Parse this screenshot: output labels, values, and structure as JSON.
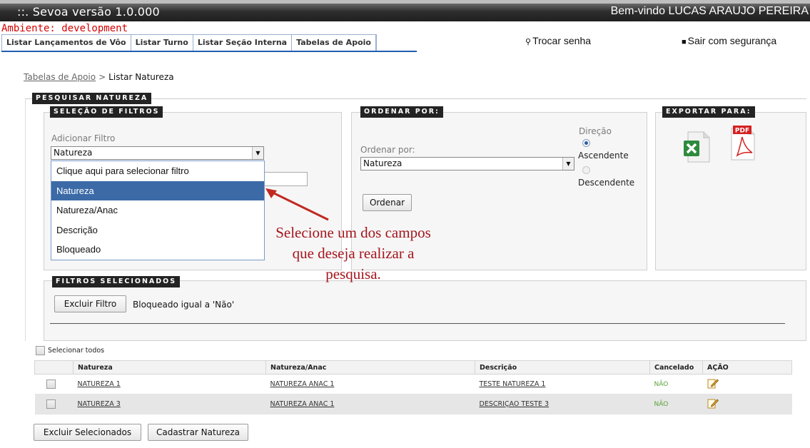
{
  "header": {
    "app_title": "::.  Sevoa versão 1.0.000",
    "welcome": "Bem-vindo LUCAS ARAUJO PEREIRA"
  },
  "environment": "Ambiente: development",
  "tabs": [
    {
      "label": "Listar Lançamentos de Vôo"
    },
    {
      "label": "Listar Turno"
    },
    {
      "label": "Listar Seção Interna"
    },
    {
      "label": "Tabelas de Apoio"
    }
  ],
  "top_links": {
    "change_password": "Trocar senha",
    "logout": "Sair com segurança"
  },
  "breadcrumb": {
    "parent": "Tabelas de Apoio",
    "separator": ">",
    "current": "Listar Natureza"
  },
  "search": {
    "legend": "PESQUISAR NATUREZA",
    "filters": {
      "legend": "SELEÇÃO DE FILTROS",
      "add_filter_label": "Adicionar Filtro",
      "selected_value": "Natureza",
      "options": [
        "Clique aqui para selecionar filtro",
        "Natureza",
        "Natureza/Anac",
        "Descrição",
        "Bloqueado"
      ],
      "highlighted_index": 1
    },
    "order": {
      "legend": "ORDENAR POR:",
      "order_by_label": "Ordenar por:",
      "order_by_value": "Natureza",
      "direction_label": "Direção",
      "asc_label": "Ascendente",
      "desc_label": "Descendente",
      "selected_direction": "asc",
      "button": "Ordenar"
    },
    "export": {
      "legend": "EXPORTAR PARA:",
      "pdf_text": "PDF"
    },
    "selected_filters": {
      "legend": "FILTROS SELECIONADOS",
      "remove_button": "Excluir Filtro",
      "active_filter": "Bloqueado igual a 'Não'"
    }
  },
  "annotation": {
    "lines": [
      "Selecione um dos campos",
      "que deseja realizar a",
      "pesquisa."
    ]
  },
  "table": {
    "select_all": "Selecionar todos",
    "columns": [
      "Natureza",
      "Natureza/Anac",
      "Descrição",
      "Cancelado",
      "AÇÃO"
    ],
    "rows": [
      {
        "natureza": "NATUREZA 1",
        "anac": "NATUREZA ANAC 1",
        "descricao": "TESTE NATUREZA 1",
        "cancelado": "NÃO"
      },
      {
        "natureza": "NATUREZA 3",
        "anac": "NATUREZA ANAC 1",
        "descricao": "DESCRIÇAO TESTE 3",
        "cancelado": "NÃO"
      }
    ]
  },
  "actions": {
    "delete_selected": "Excluir Selecionados",
    "add_new": "Cadastrar Natureza"
  },
  "colors": {
    "accent_red": "#d40000",
    "annotation_red": "#a5151d",
    "highlight_blue": "#3b6aa7"
  }
}
